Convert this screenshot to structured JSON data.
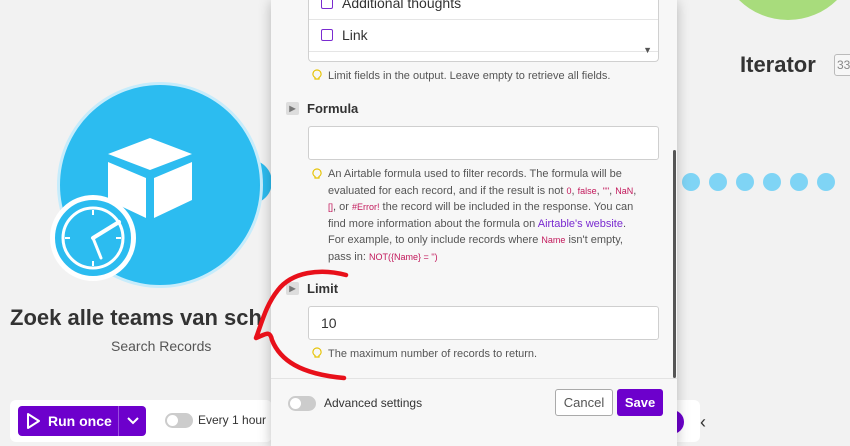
{
  "canvas": {
    "iterator_label": "Iterator",
    "iterator_badge": "33",
    "node_title": "Zoek alle teams van sch",
    "node_subtitle": "Search Records",
    "node_color": "#2cbcf0"
  },
  "toolbar": {
    "run_label": "Run once",
    "schedule_label": "Every 1 hour"
  },
  "panel": {
    "field_options": [
      "Additional thoughts",
      "Link"
    ],
    "fields_hint": "Limit fields in the output. Leave empty to retrieve all fields.",
    "formula": {
      "label": "Formula",
      "value": "",
      "hint_1": "An Airtable formula used to filter records. The formula will be",
      "hint_2a": "evaluated for each record, and if the result is not ",
      "hint_2_codes": [
        "0",
        "false",
        "\"\"",
        "NaN"
      ],
      "hint_3_code_a": "[]",
      "hint_3_code_b": "#Error!",
      "hint_3b": " the record will be included in the response. You can",
      "hint_4a": "find more information about the formula on ",
      "hint_4_link": "Airtable's website",
      "hint_5a": "For example, to only include records where ",
      "hint_5_code": "Name",
      "hint_5b": " isn't empty,",
      "hint_6a": "pass in: ",
      "hint_6_code": "NOT({Name} = '')"
    },
    "limit": {
      "label": "Limit",
      "value": "10",
      "hint": "The maximum number of records to return."
    },
    "advanced_label": "Advanced settings",
    "cancel_label": "Cancel",
    "save_label": "Save",
    "accent_color": "#6d00cc"
  }
}
